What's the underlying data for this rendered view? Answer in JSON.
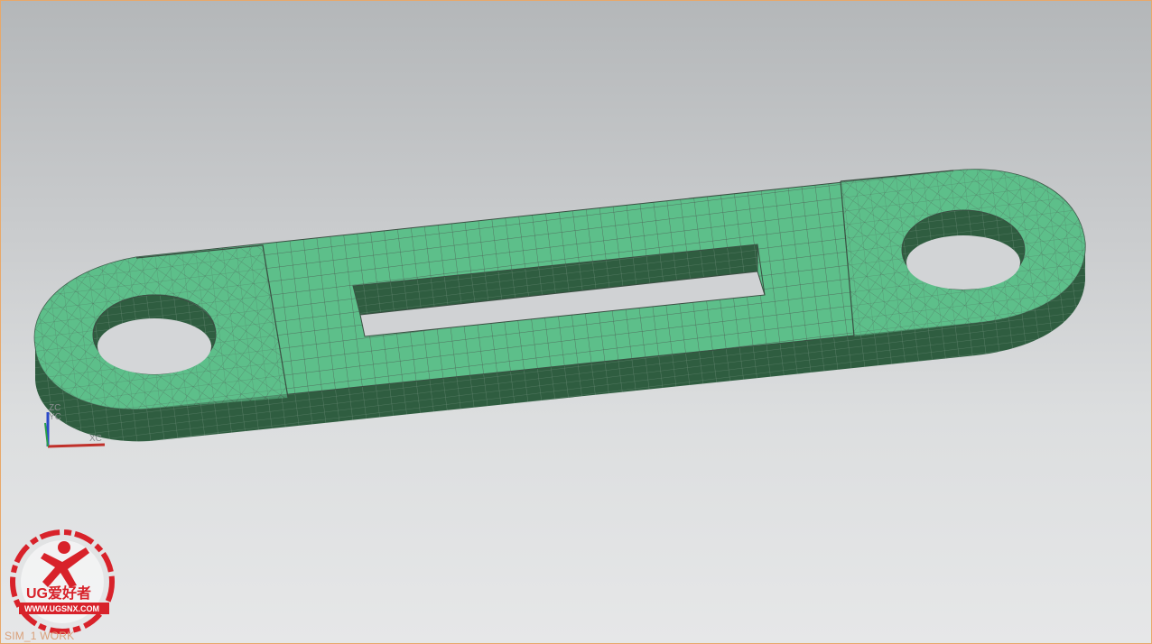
{
  "viewport": {
    "status_label": "SIM_1 WORK",
    "background_top": "#b4b7b9",
    "background_bottom": "#e6e7e8",
    "border_color": "#e8a86a"
  },
  "model": {
    "mesh_top_color": "#5dbf8a",
    "mesh_side_color": "#2f5d40",
    "mesh_line_color": "#4d5a52",
    "icons": [
      "hex-mesh-plate-model"
    ]
  },
  "triad": {
    "x_label": "XC",
    "y_label": "YC",
    "z_label": "ZC"
  },
  "watermark": {
    "brand": "UG爱好者",
    "url": "WWW.UGSNX.COM",
    "color": "#d8222a"
  }
}
